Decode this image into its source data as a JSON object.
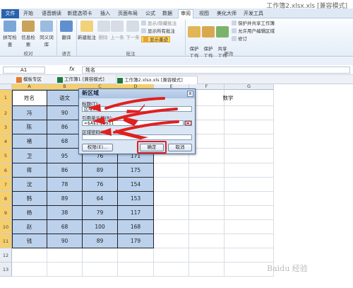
{
  "window": {
    "title": "工作簿2.xlsx.xls [兼容模式]"
  },
  "ribbon_tabs": [
    "文件",
    "开始",
    "语音朗读",
    "新建选项卡",
    "插入",
    "页面布局",
    "公式",
    "数据",
    "审阅",
    "视图",
    "美化大师",
    "开发工具"
  ],
  "active_tab": "审阅",
  "ribbon": {
    "proof": {
      "spell_check": "拼写检查",
      "research": "信息检索",
      "thesaurus": "同义词库",
      "group": "校对"
    },
    "language": {
      "translate": "翻译",
      "group": "语言"
    },
    "comments": {
      "new_comment": "新建批注",
      "delete": "删除",
      "previous": "上一条",
      "next": "下一条",
      "show_hide": "显示/隐藏批注",
      "show_all": "显示所有批注",
      "show_ink": "显示墨迹",
      "group": "批注"
    },
    "changes": {
      "protect_sheet": "保护\n工作表",
      "protect_workbook": "保护\n工作簿",
      "share_workbook": "共享\n工作簿",
      "protect_and_share": "保护并共享工作簿",
      "allow_edit_ranges": "允许用户编辑区域",
      "track_changes": "修订",
      "group": "更改"
    }
  },
  "formula_bar": {
    "name_box": "A1",
    "fx": "fx",
    "content": "姓名"
  },
  "workbook_tabs": [
    "模板专区",
    "工作簿1 [兼容模式]",
    "工作簿2.xlsx.xls [兼容模式]"
  ],
  "columns": [
    "A",
    "B",
    "C",
    "D",
    "E",
    "F",
    "G"
  ],
  "rows": [
    "1",
    "2",
    "3",
    "4",
    "5",
    "6",
    "7",
    "8",
    "9",
    "10",
    "11",
    "12",
    "13"
  ],
  "table": {
    "headers": [
      "姓名",
      "语文",
      "",
      ""
    ],
    "extra_header": "数学",
    "rows": [
      [
        "冯",
        "90",
        "",
        ""
      ],
      [
        "陈",
        "86",
        "",
        ""
      ],
      [
        "褚",
        "68",
        "",
        ""
      ],
      [
        "卫",
        "95",
        "76",
        "171"
      ],
      [
        "蒋",
        "86",
        "89",
        "175"
      ],
      [
        "沈",
        "78",
        "76",
        "154"
      ],
      [
        "韩",
        "89",
        "64",
        "153"
      ],
      [
        "杨",
        "38",
        "79",
        "117"
      ],
      [
        "赵",
        "68",
        "100",
        "168"
      ],
      [
        "钱",
        "90",
        "89",
        "179"
      ]
    ]
  },
  "dialog": {
    "title": "新区域",
    "close": "x",
    "title_label": "标题(T):",
    "title_value": "区域1",
    "ref_label": "引用单元格(R):",
    "ref_value": "=$A$1:$D$11",
    "password_label": "区域密码(P):",
    "password_value": "",
    "permissions_button": "权限(E)...",
    "ok_button": "确定",
    "cancel_button": "取消"
  },
  "watermark": "Baidu 经验"
}
